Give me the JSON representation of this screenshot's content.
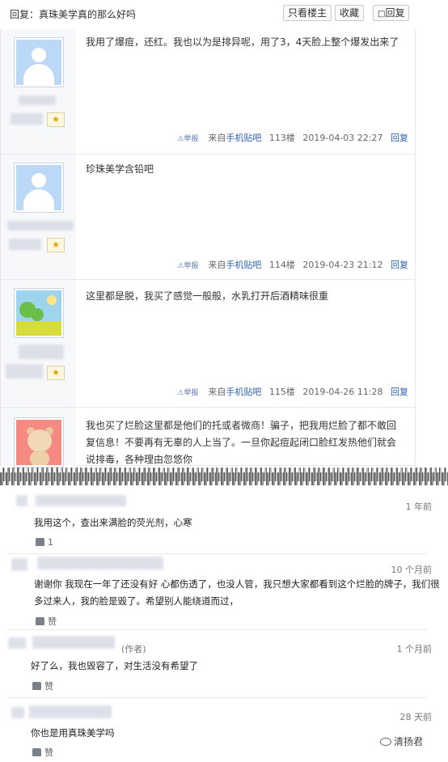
{
  "header": {
    "thread_title": "回复：真珠美学真的那么好吗",
    "only_op_label": "只看楼主",
    "favorite_label": "收藏",
    "reply_label": "回复",
    "reply_icon": "speech-bubble-icon"
  },
  "posts": [
    {
      "text": "我用了爆痘，还红。我也以为是排异呢，用了3，4天脸上整个爆发出来了",
      "report": "⚠举报",
      "source_prefix": "来自",
      "source_link": "手机贴吧",
      "floor": "113楼",
      "time": "2019-04-03 22:27",
      "reply": "回复",
      "avatar": "default-avatar"
    },
    {
      "text": "珍珠美学含铅吧",
      "report": "⚠举报",
      "source_prefix": "来自",
      "source_link": "手机贴吧",
      "floor": "114楼",
      "time": "2019-04-23 21:12",
      "reply": "回复",
      "avatar": "default-avatar"
    },
    {
      "text": "这里都是脱，我买了感觉一般般，水乳打开后酒精味很重",
      "report": "⚠举报",
      "source_prefix": "来自",
      "source_link": "手机贴吧",
      "floor": "115楼",
      "time": "2019-04-26 11:28",
      "reply": "回复",
      "avatar": "landscape-avatar"
    },
    {
      "text": "我也买了烂脸这里都是他们的托或者微商！骗子，把我用烂脸了都不敢回复信息！不要再有无辜的人上当了。一旦你起痘起闭口脸红发热他们就会说排毒，各种理由忽悠你",
      "avatar": "bear-avatar"
    }
  ],
  "comments": [
    {
      "time": "1 年前",
      "text": "我用这个，查出来满脸的荧光剂，心寒",
      "likes": "1"
    },
    {
      "time": "10 个月前",
      "text": "谢谢你 我现在一年了还没有好 心都伤透了，也没人管，我只想大家都看到这个烂脸的牌子，我们很多过来人，我的脸是毁了。希望别人能绕道而过，",
      "likes": "赞"
    },
    {
      "time": "1 个月前",
      "author_tag": "(作者)",
      "text": "好了么，我也毁容了，对生活没有希望了",
      "likes": "赞"
    },
    {
      "time": "28 天前",
      "text": "你也是用真珠美学吗",
      "likes": "赞"
    }
  ],
  "watermark": "清扬君",
  "colors": {
    "link": "#2d64b3",
    "avatar_blue": "#bcd8f7",
    "badge_gold": "#e8a400"
  }
}
